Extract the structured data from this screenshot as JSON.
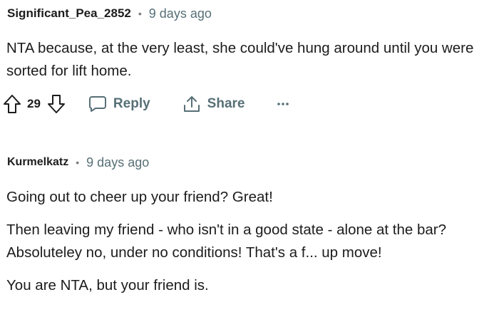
{
  "comments": [
    {
      "author": "Significant_Pea_2852",
      "separator": "•",
      "time": "9 days ago",
      "paragraphs": [
        "NTA because, at the very least, she could've hung around until you were sorted for lift home."
      ],
      "score": "29",
      "reply_label": "Reply",
      "share_label": "Share"
    },
    {
      "author": "Kurmelkatz",
      "separator": "•",
      "time": "9 days ago",
      "paragraphs": [
        "Going out to cheer up your friend? Great!",
        "Then leaving my friend - who isn't in a good state - alone at the bar? Absoluteley no, under no conditions! That's a f... up move!",
        "You are NTA, but your friend is."
      ]
    }
  ],
  "icons": {
    "upvote": "arrow-up-outline-icon",
    "downvote": "arrow-down-outline-icon",
    "reply": "speech-bubble-icon",
    "share": "share-upload-icon",
    "more": "ellipsis-icon"
  },
  "colors": {
    "text": "#1c1c1c",
    "meta": "#576f76",
    "separator": "#787c7e"
  }
}
